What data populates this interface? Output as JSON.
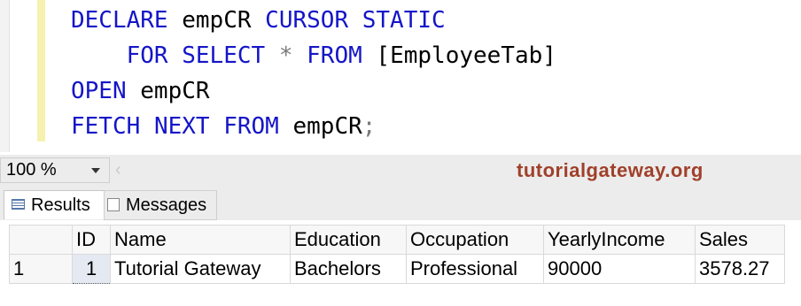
{
  "editor": {
    "lines": [
      {
        "parts": [
          {
            "t": "DECLARE",
            "k": "kw"
          },
          {
            "t": " ",
            "k": "id"
          },
          {
            "t": "empCR",
            "k": "id"
          },
          {
            "t": " ",
            "k": "id"
          },
          {
            "t": "CURSOR",
            "k": "kw"
          },
          {
            "t": " ",
            "k": "id"
          },
          {
            "t": "STATIC",
            "k": "kw"
          }
        ]
      },
      {
        "parts": [
          {
            "t": "    ",
            "k": "id"
          },
          {
            "t": "FOR",
            "k": "kw"
          },
          {
            "t": " ",
            "k": "id"
          },
          {
            "t": "SELECT",
            "k": "kw"
          },
          {
            "t": " ",
            "k": "id"
          },
          {
            "t": "*",
            "k": "op"
          },
          {
            "t": " ",
            "k": "id"
          },
          {
            "t": "FROM",
            "k": "kw"
          },
          {
            "t": " ",
            "k": "id"
          },
          {
            "t": "[EmployeeTab]",
            "k": "id"
          }
        ]
      },
      {
        "parts": [
          {
            "t": "OPEN",
            "k": "kw"
          },
          {
            "t": " ",
            "k": "id"
          },
          {
            "t": "empCR",
            "k": "id"
          }
        ]
      },
      {
        "parts": [
          {
            "t": "FETCH",
            "k": "kw"
          },
          {
            "t": " ",
            "k": "id"
          },
          {
            "t": "NEXT",
            "k": "kw"
          },
          {
            "t": " ",
            "k": "id"
          },
          {
            "t": "FROM",
            "k": "kw"
          },
          {
            "t": " ",
            "k": "id"
          },
          {
            "t": "empCR",
            "k": "id"
          },
          {
            "t": ";",
            "k": "op"
          }
        ]
      }
    ]
  },
  "zoom": {
    "value": "100 %"
  },
  "watermark": "tutorialgateway.org",
  "tabs": {
    "results": "Results",
    "messages": "Messages"
  },
  "grid": {
    "columns": [
      "ID",
      "Name",
      "Education",
      "Occupation",
      "YearlyIncome",
      "Sales"
    ],
    "rows": [
      {
        "rownum": "1",
        "cells": [
          "1",
          "Tutorial Gateway",
          "Bachelors",
          "Professional",
          "90000",
          "3578.27"
        ]
      }
    ]
  },
  "colors": {
    "keyword": "#1515c8",
    "watermark": "#a0402a",
    "editor_margin": "#f7f1b0"
  }
}
